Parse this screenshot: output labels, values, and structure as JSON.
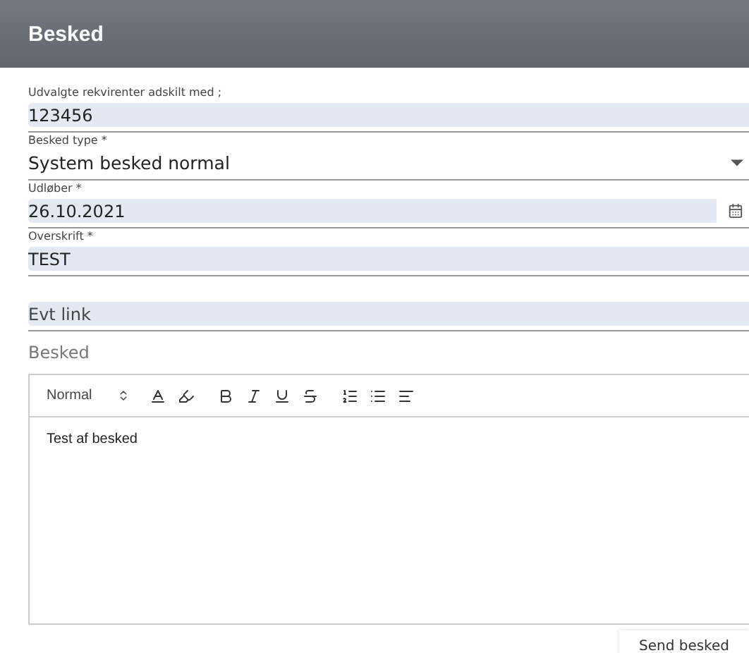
{
  "header": {
    "title": "Besked"
  },
  "fields": [
    {
      "kind": "text",
      "label": "Udvalgte rekvirenter adskilt med ;",
      "value": "123456"
    },
    {
      "kind": "select",
      "label": "Besked type *",
      "value": "System besked normal"
    },
    {
      "kind": "date",
      "label": "Udløber *",
      "value": "26.10.2021"
    },
    {
      "kind": "text",
      "label": "Overskrift *",
      "value": "TEST"
    },
    {
      "kind": "text",
      "placeholder": "Evt link"
    }
  ],
  "editor": {
    "label": "Besked",
    "format": "Normal",
    "content": "Test af besked"
  },
  "send_button": "Send besked"
}
